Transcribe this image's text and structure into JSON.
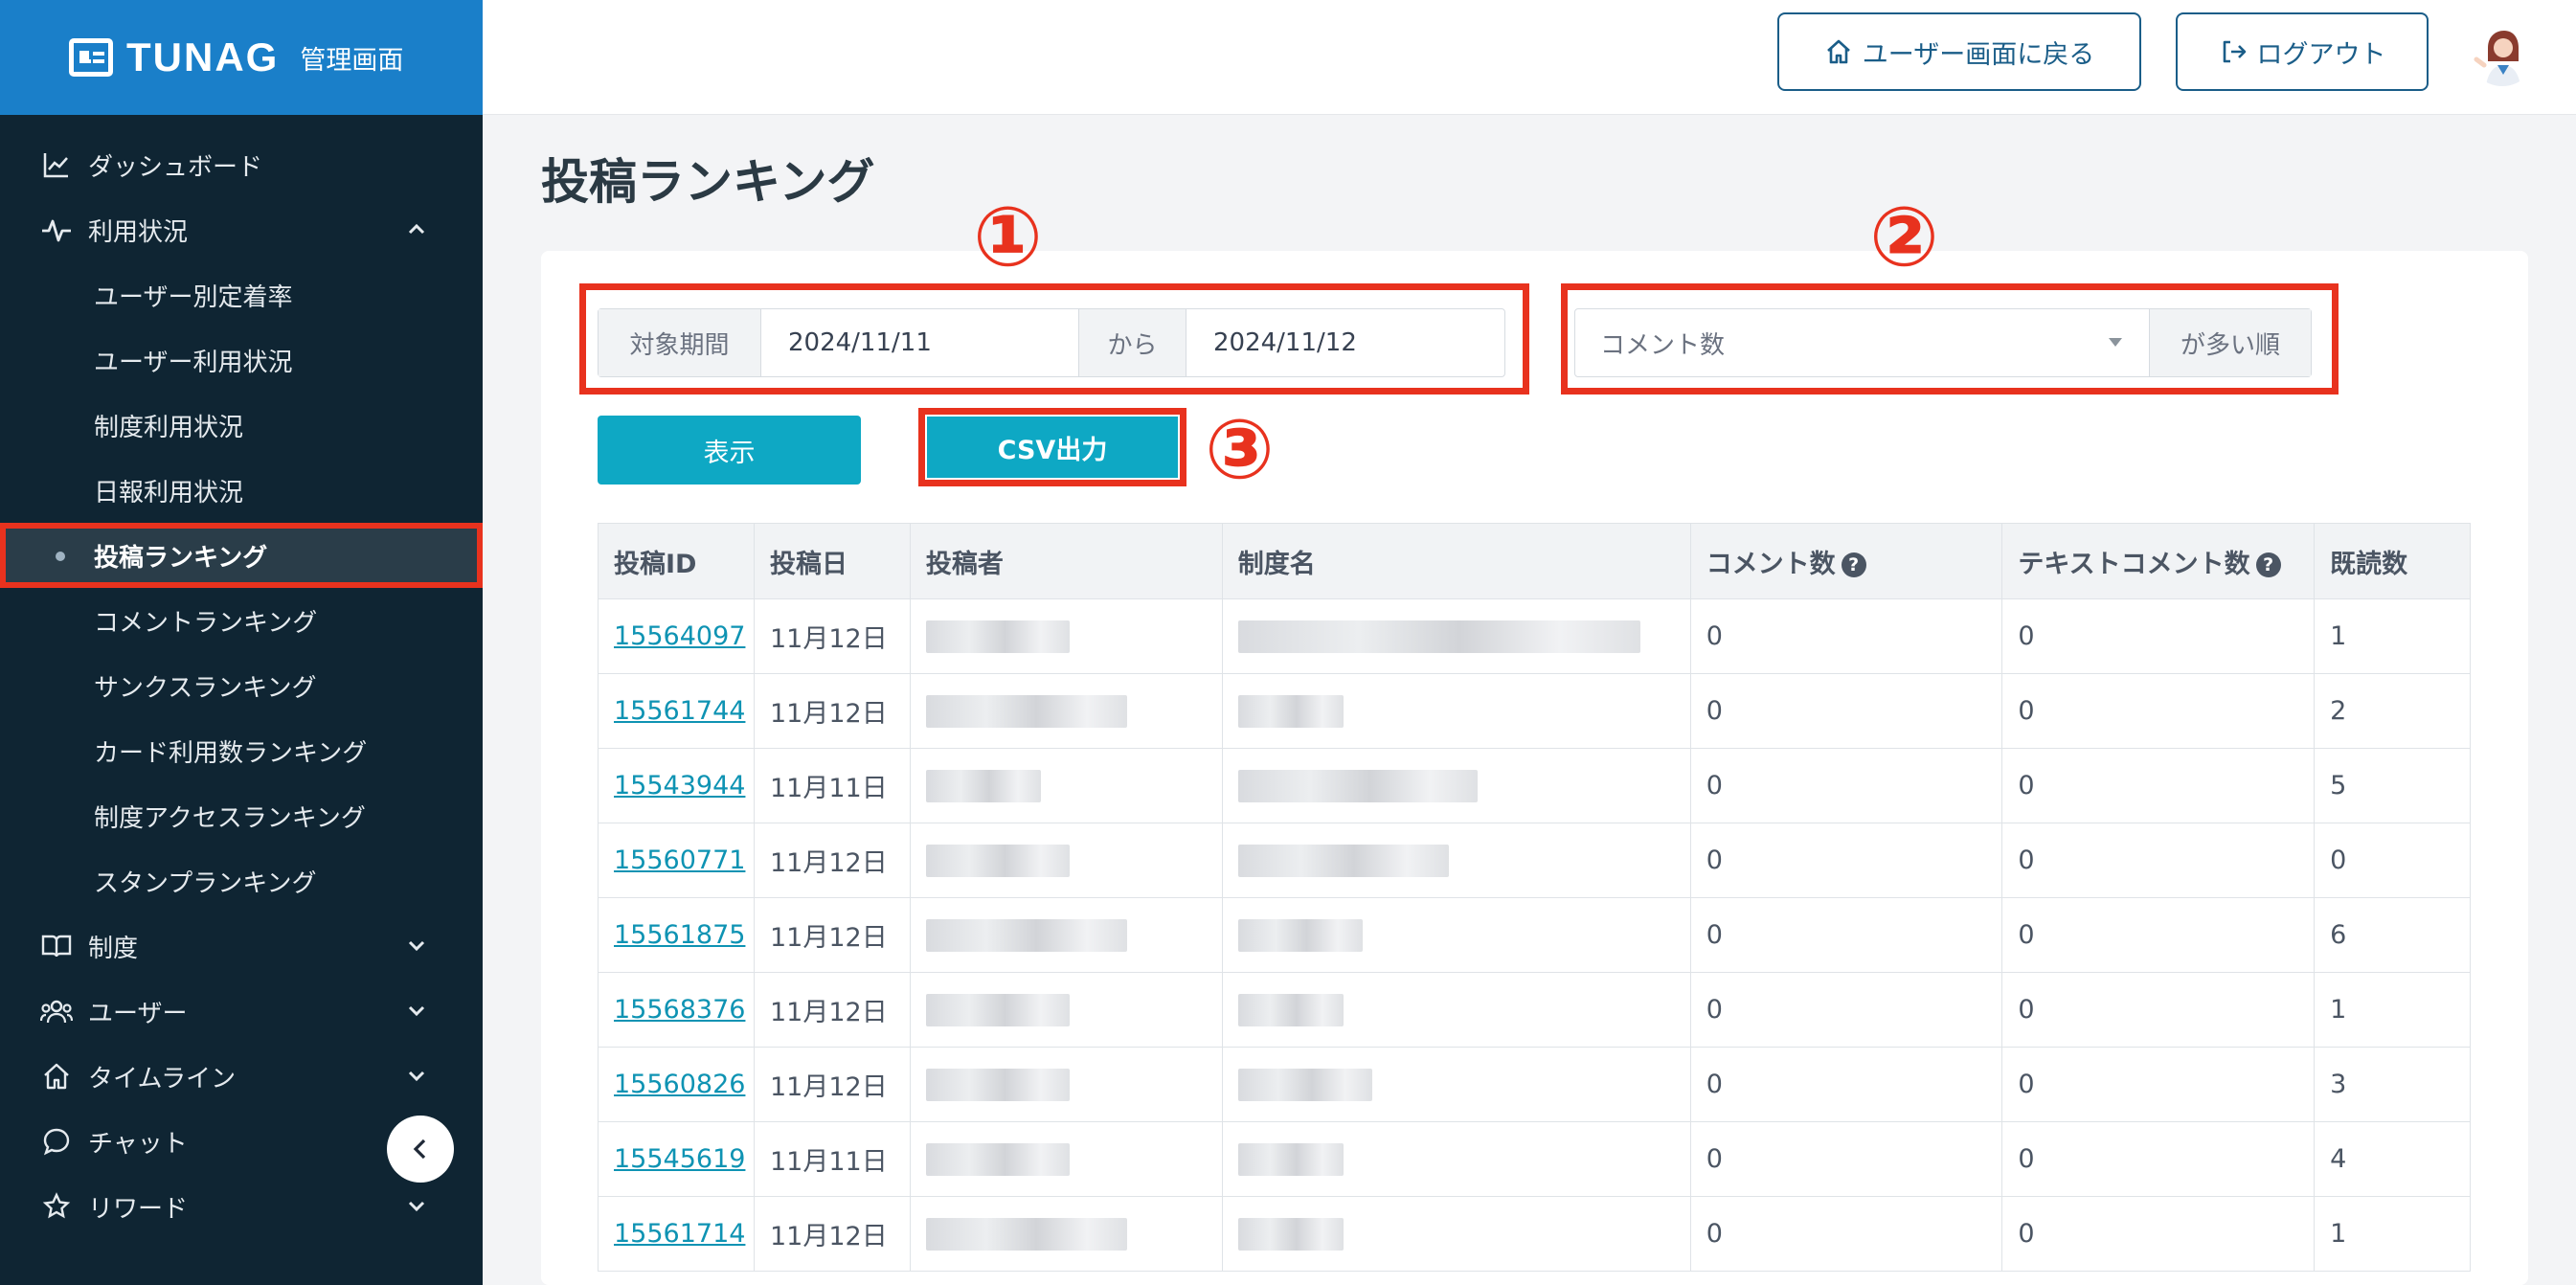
{
  "brand": {
    "name": "TUNAG",
    "subtitle": "管理画面"
  },
  "colors": {
    "accent": "#0ea8c4",
    "brand": "#1a7fc9",
    "highlight": "#e8321e",
    "sidebar": "#0f2533"
  },
  "sidebar": {
    "items": [
      {
        "label": "ダッシュボード",
        "icon": "chart-line-icon"
      },
      {
        "label": "利用状況",
        "icon": "pulse-icon",
        "expanded": true,
        "children": [
          {
            "label": "ユーザー別定着率"
          },
          {
            "label": "ユーザー利用状況"
          },
          {
            "label": "制度利用状況"
          },
          {
            "label": "日報利用状況"
          },
          {
            "label": "投稿ランキング",
            "active": true
          },
          {
            "label": "コメントランキング"
          },
          {
            "label": "サンクスランキング"
          },
          {
            "label": "カード利用数ランキング"
          },
          {
            "label": "制度アクセスランキング"
          },
          {
            "label": "スタンプランキング"
          }
        ]
      },
      {
        "label": "制度",
        "icon": "book-icon"
      },
      {
        "label": "ユーザー",
        "icon": "users-icon"
      },
      {
        "label": "タイムライン",
        "icon": "home-icon"
      },
      {
        "label": "チャット",
        "icon": "chat-icon"
      },
      {
        "label": "リワード",
        "icon": "star-icon"
      }
    ]
  },
  "header": {
    "back_label": "ユーザー画面に戻る",
    "logout_label": "ログアウト"
  },
  "main": {
    "title": "投稿ランキング",
    "filter": {
      "period_label": "対象期間",
      "from_date": "2024/11/11",
      "between_label": "から",
      "to_date": "2024/11/12",
      "sort_value": "コメント数",
      "sort_suffix": "が多い順"
    },
    "markers": [
      "①",
      "②",
      "③"
    ],
    "show_button": "表示",
    "csv_button": "CSV出力",
    "table": {
      "headers": [
        "投稿ID",
        "投稿日",
        "投稿者",
        "制度名",
        "コメント数",
        "テキストコメント数",
        "既読数"
      ],
      "rows": [
        {
          "id": "15564097",
          "date": "11月12日",
          "comments": "0",
          "text_comments": "0",
          "reads": "1"
        },
        {
          "id": "15561744",
          "date": "11月12日",
          "comments": "0",
          "text_comments": "0",
          "reads": "2"
        },
        {
          "id": "15543944",
          "date": "11月11日",
          "comments": "0",
          "text_comments": "0",
          "reads": "5"
        },
        {
          "id": "15560771",
          "date": "11月12日",
          "comments": "0",
          "text_comments": "0",
          "reads": "0"
        },
        {
          "id": "15561875",
          "date": "11月12日",
          "comments": "0",
          "text_comments": "0",
          "reads": "6"
        },
        {
          "id": "15568376",
          "date": "11月12日",
          "comments": "0",
          "text_comments": "0",
          "reads": "1"
        },
        {
          "id": "15560826",
          "date": "11月12日",
          "comments": "0",
          "text_comments": "0",
          "reads": "3"
        },
        {
          "id": "15545619",
          "date": "11月11日",
          "comments": "0",
          "text_comments": "0",
          "reads": "4"
        },
        {
          "id": "15561714",
          "date": "11月12日",
          "comments": "0",
          "text_comments": "0",
          "reads": "1"
        }
      ]
    }
  }
}
